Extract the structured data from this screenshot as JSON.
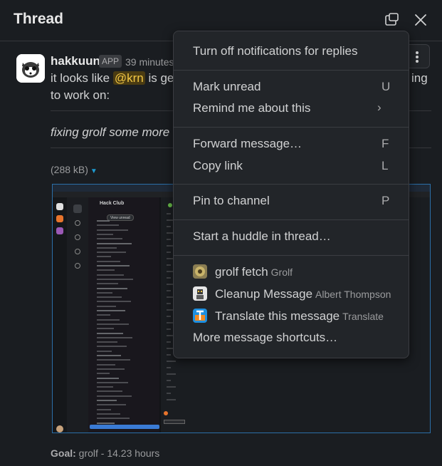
{
  "header": {
    "title": "Thread"
  },
  "message": {
    "author": "hakkuun",
    "badge": "APP",
    "timestamp": "39 minutes",
    "text_before": "it looks like ",
    "mention": "@krn",
    "text_after": " is gett",
    "text_tail": "ing",
    "line2": "to work on:",
    "italic": "fixing grolf some more",
    "file_size": "(288 kB)",
    "goal_label": "Goal:",
    "goal_value": " grolf - 14.23 hours"
  },
  "menu": {
    "notifications": "Turn off notifications for replies",
    "mark_unread": {
      "label": "Mark unread",
      "key": "U"
    },
    "remind": {
      "label": "Remind me about this",
      "chevron": "›"
    },
    "forward": {
      "label": "Forward message…",
      "key": "F"
    },
    "copy_link": {
      "label": "Copy link",
      "key": "L"
    },
    "pin": {
      "label": "Pin to channel",
      "key": "P"
    },
    "huddle": "Start a huddle in thread…",
    "shortcuts": [
      {
        "label": "grolf fetch",
        "app": "Grolf",
        "icon": "grolf-icon"
      },
      {
        "label": "Cleanup Message",
        "app": "Albert Thompson",
        "icon": "cleanup-bot-icon"
      },
      {
        "label": "Translate this message",
        "app": "Translate",
        "icon": "translate-icon"
      }
    ],
    "more": "More message shortcuts…"
  },
  "screenshot_preview": {
    "workspace": "Hack Club",
    "button": "View unread"
  },
  "colors": {
    "background": "#1a1d21",
    "menu_bg": "#222529",
    "mention_bg": "#4a3b12",
    "mention_fg": "#f2c744",
    "link_blue": "#1d9bd1"
  }
}
